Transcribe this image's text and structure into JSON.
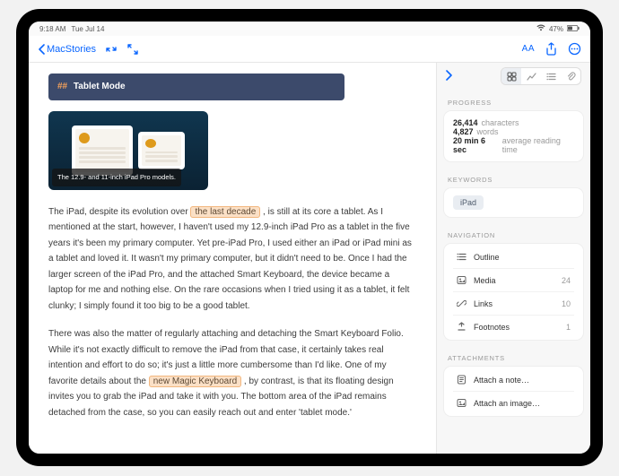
{
  "status": {
    "time": "9:18 AM",
    "date": "Tue Jul 14",
    "battery": "47%"
  },
  "toolbar": {
    "back_label": "MacStories",
    "aa_label": "AA"
  },
  "editor": {
    "heading_marker": "##",
    "heading_text": "Tablet Mode",
    "figure_caption": "The 12.9- and 11-inch iPad Pro models.",
    "para1_a": "The iPad, despite its evolution over ",
    "hl1": "the last decade",
    "para1_b": ", is still at its core a tablet. As I mentioned at the start, however, I haven't used my 12.9-inch iPad Pro as a tablet in the five years it's been my primary computer. Yet pre-iPad Pro, I used either an iPad or iPad mini as a tablet and loved it. It wasn't my primary computer, but it didn't need to be. Once I had the larger screen of the iPad Pro, and the attached Smart Keyboard, the device became a laptop for me and nothing else. On the rare occasions when I tried using it as a tablet, it felt clunky; I simply found it too big to be a good tablet.",
    "para2_a": "There was also the matter of regularly attaching and detaching the Smart Keyboard Folio. While it's not exactly difficult to remove the iPad from that case, it certainly takes real intention and effort to do so; it's just a little more cumbersome than I'd like. One of my favorite details about the ",
    "hl2": "new Magic Keyboard",
    "para2_b": ", by contrast, is that its floating design invites you to grab the iPad and take it with you. The bottom area of the iPad remains detached from the case, so you can easily reach out and enter 'tablet mode.'"
  },
  "inspector": {
    "progress_label": "PROGRESS",
    "chars_n": "26,414",
    "chars_l": "characters",
    "words_n": "4,827",
    "words_l": "words",
    "time_n": "20 min 6 sec",
    "time_l": "average reading time",
    "keywords_label": "KEYWORDS",
    "keyword_1": "iPad",
    "navigation_label": "NAVIGATION",
    "nav": {
      "outline": "Outline",
      "media": "Media",
      "media_n": "24",
      "links": "Links",
      "links_n": "10",
      "footnotes": "Footnotes",
      "footnotes_n": "1"
    },
    "attachments_label": "ATTACHMENTS",
    "attach_note": "Attach a note…",
    "attach_image": "Attach an image…"
  }
}
